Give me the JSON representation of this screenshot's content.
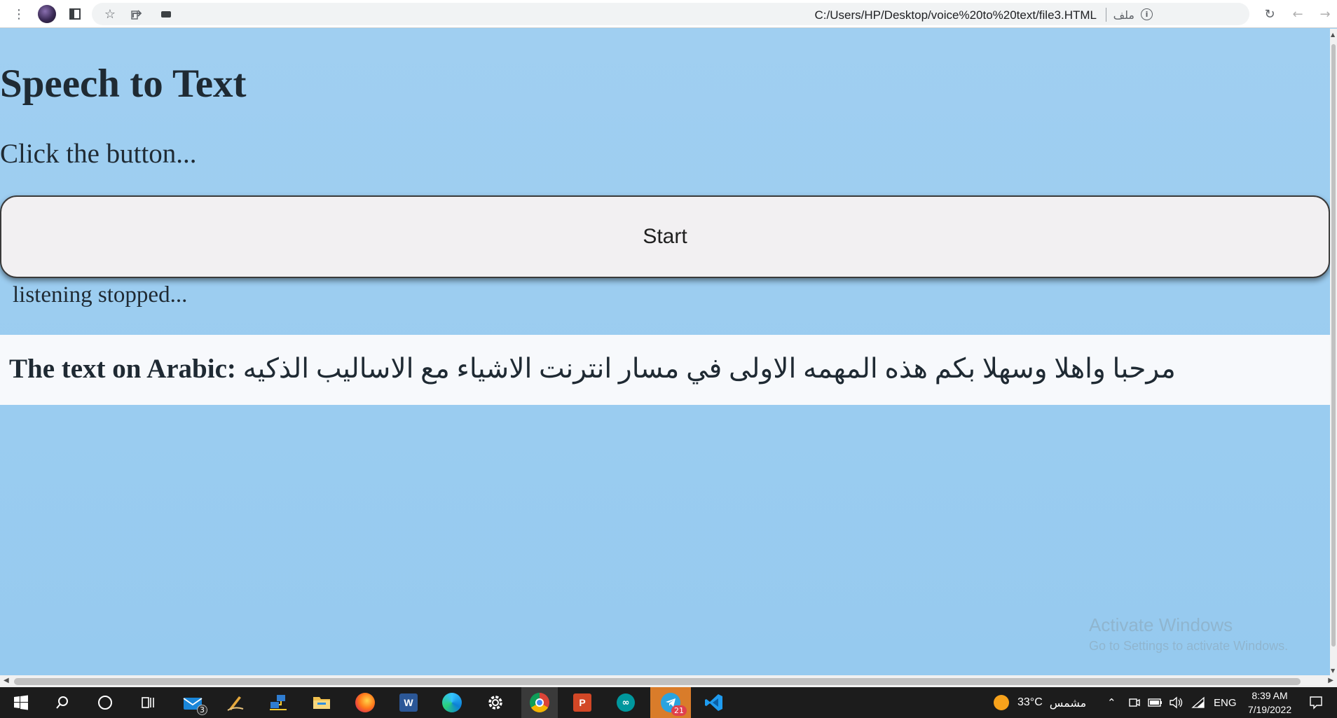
{
  "browser": {
    "url": "C:/Users/HP/Desktop/voice%20to%20text/file3.HTML",
    "site_label": "ملف",
    "menu_icon": "⋮",
    "reload_icon": "↻",
    "back_icon": "←",
    "forward_icon": "→",
    "star_icon": "☆",
    "info_icon": "i"
  },
  "page": {
    "title": "Speech to Text",
    "instruction": "Click the button...",
    "button_label": "Start",
    "status": "listening stopped...",
    "result_label": "The text on Arabic:",
    "result_text": "مرحبا واهلا وسهلا بكم هذه المهمه الاولى في مسار انترنت الاشياء مع الاساليب الذكيه"
  },
  "watermark": {
    "title": "Activate Windows",
    "subtitle": "Go to Settings to activate Windows."
  },
  "taskbar": {
    "apps": [
      {
        "name": "mail",
        "badge": "3"
      },
      {
        "name": "telegram",
        "badge": "21"
      }
    ],
    "word_letter": "W",
    "powerpoint_letter": "P",
    "weather_temp": "33°C",
    "weather_text": "مشمس",
    "language": "ENG",
    "time": "8:39 AM",
    "date": "7/19/2022"
  },
  "colors": {
    "page_background": "#9ccdee",
    "result_background": "#f7f9fc",
    "button_background": "#f2f0f2",
    "taskbar": "#1c1c1c"
  }
}
